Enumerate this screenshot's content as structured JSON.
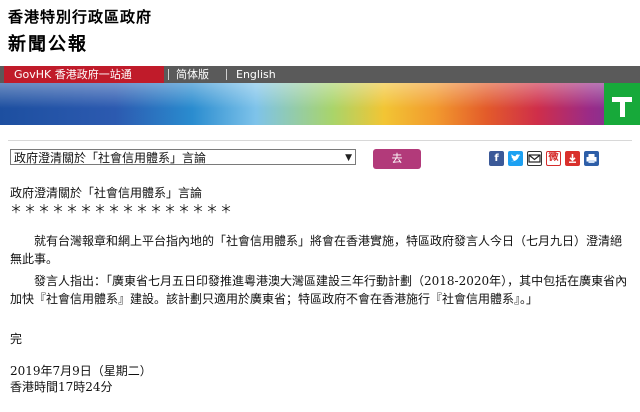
{
  "header": {
    "gov_title": "香港特別行政區政府",
    "press_title": "新聞公報"
  },
  "nav": {
    "govhk": "GovHK 香港政府一站通",
    "simplified": "简体版",
    "english": "English"
  },
  "colors": {
    "nav_bg": "#5a5a5a",
    "govhk_red": "#c01b2a",
    "go_button": "#b23a7a"
  },
  "toolbar": {
    "select_value": "政府澄清關於「社會信用體系」言論",
    "go_label": "去",
    "icons": [
      "facebook-icon",
      "twitter-icon",
      "email-icon",
      "weibo-icon",
      "download-icon",
      "print-icon"
    ]
  },
  "article": {
    "subject": "政府澄清關於「社會信用體系」言論",
    "stars": "＊＊＊＊＊＊＊＊＊＊＊＊＊＊＊＊",
    "para1": "就有台灣報章和網上平台指內地的「社會信用體系」將會在香港實施，特區政府發言人今日（七月九日）澄清絕無此事。",
    "para2": "發言人指出：「廣東省七月五日印發推進粵港澳大灣區建設三年行動計劃（2018-2020年），其中包括在廣東省內加快『社會信用體系』建設。該計劃只適用於廣東省；特區政府不會在香港施行『社會信用體系』。」",
    "end": "完",
    "date": "2019年7月9日（星期二）",
    "time": "香港時間17時24分"
  }
}
